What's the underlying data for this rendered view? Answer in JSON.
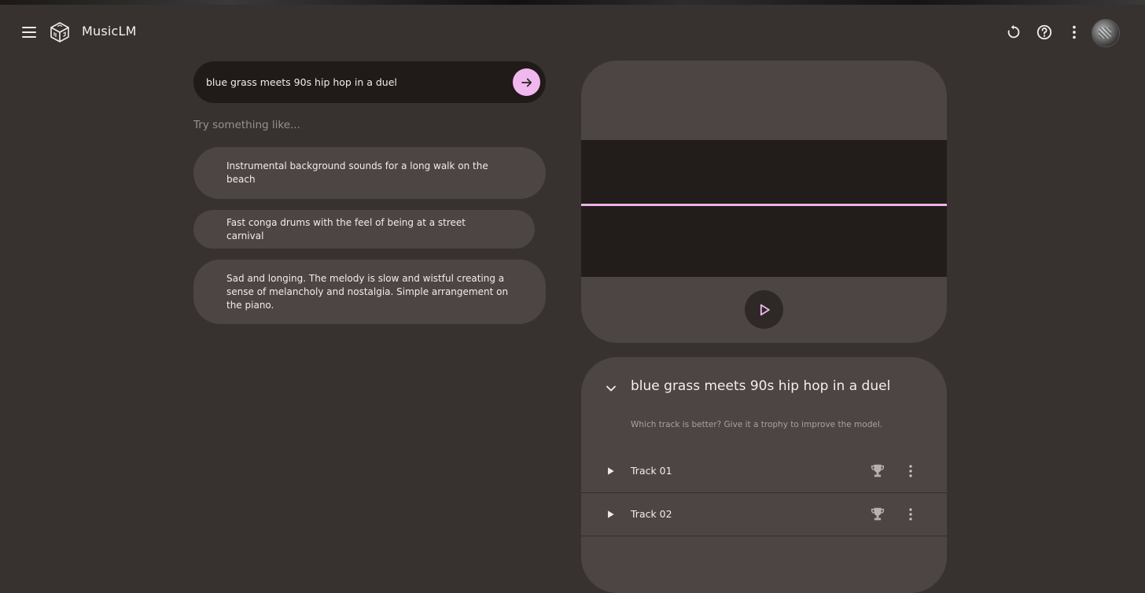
{
  "header": {
    "app_title": "MusicLM",
    "icons": [
      "menu-icon",
      "musiclm-logo-icon",
      "refresh-icon",
      "help-icon",
      "more-vert-icon",
      "avatar"
    ]
  },
  "prompt": {
    "value": "blue grass meets 90s hip hop in a duel",
    "submit_icon": "arrow-right-icon"
  },
  "suggestions": {
    "label": "Try something like...",
    "items": [
      "Instrumental background sounds for a long walk on the beach",
      "Fast conga drums with the feel of being at a street carnival",
      "Sad and longing. The melody is slow and wistful creating a sense of melancholy and nostalgia. Simple arrangement on the piano."
    ]
  },
  "player": {
    "play_icon": "play-outline-icon"
  },
  "result": {
    "title": "blue grass meets 90s hip hop in a duel",
    "subtitle": "Which track is better? Give it a trophy to improve the model.",
    "tracks": [
      {
        "name": "Track 01"
      },
      {
        "name": "Track 02"
      }
    ]
  },
  "colors": {
    "background": "#37312f",
    "card": "#4c4543",
    "input_bg": "#201a19",
    "accent": "#f0b8ee",
    "waveform_bg": "#221c1a"
  }
}
